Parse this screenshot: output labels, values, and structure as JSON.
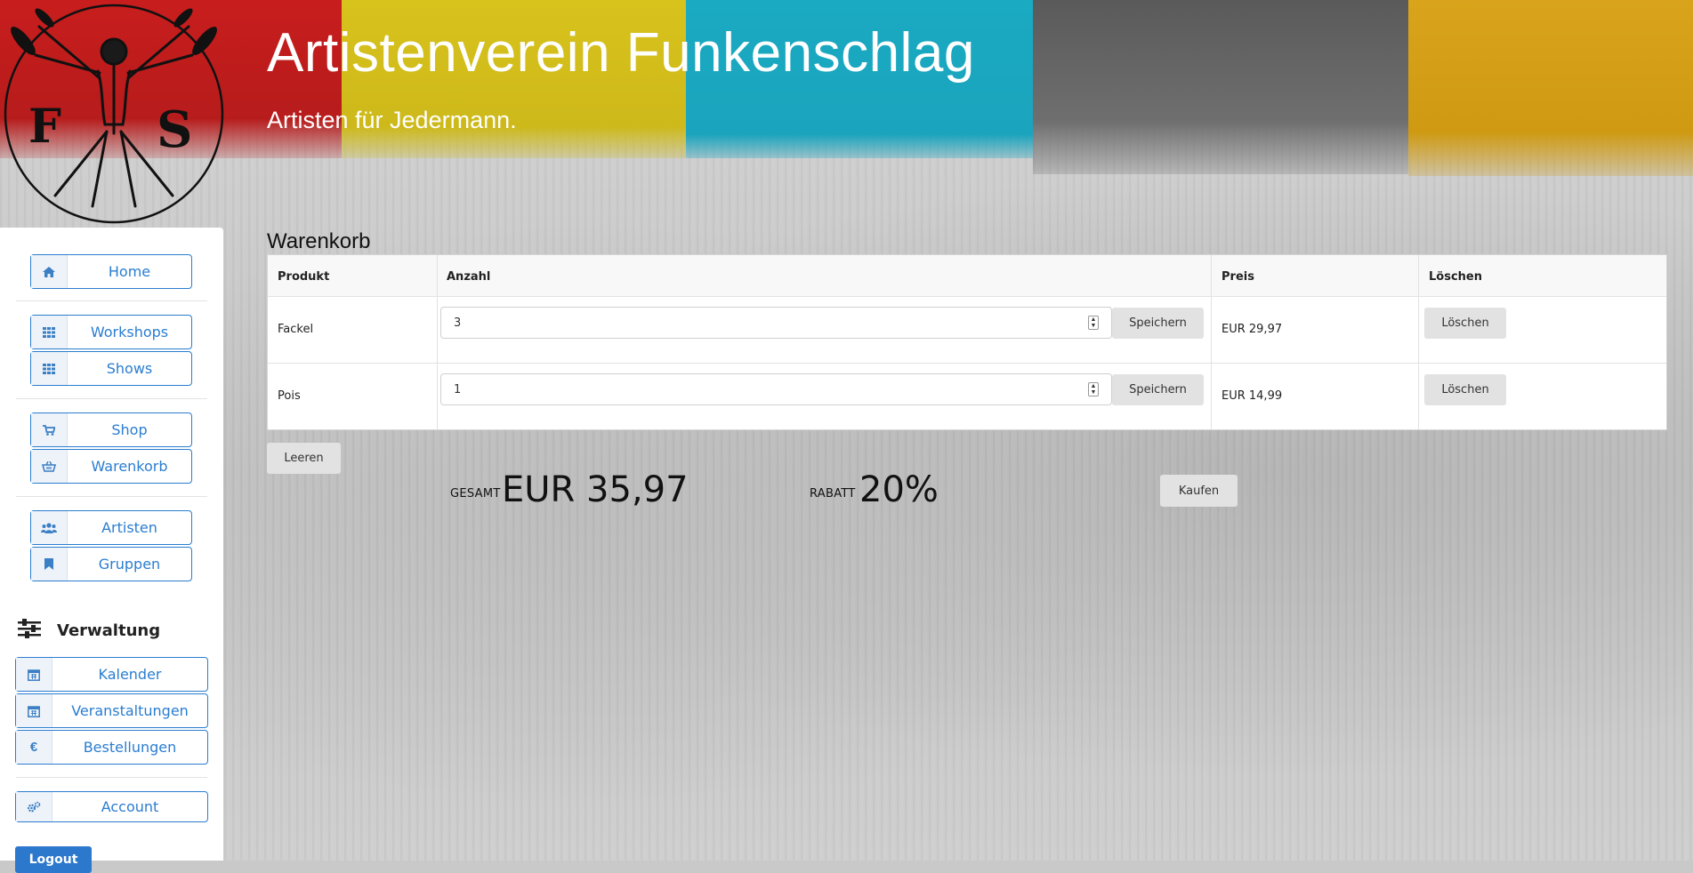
{
  "header": {
    "title": "Artistenverein Funkenschlag",
    "subtitle": "Artisten für Jedermann.",
    "logo_letters": [
      "F",
      "S"
    ]
  },
  "colors": {
    "accent": "#2a7dd0",
    "band_red": "#c81d1d",
    "band_yellow": "#d8c21c",
    "band_cyan": "#1aaac2",
    "band_gray": "#5a5a5a",
    "band_orange": "#d9a41b"
  },
  "sidebar": {
    "items": [
      {
        "label": "Home",
        "icon": "home-icon"
      },
      {
        "label": "Workshops",
        "icon": "grid-icon"
      },
      {
        "label": "Shows",
        "icon": "grid-icon"
      },
      {
        "label": "Shop",
        "icon": "cart-icon"
      },
      {
        "label": "Warenkorb",
        "icon": "basket-icon"
      },
      {
        "label": "Artisten",
        "icon": "users-icon"
      },
      {
        "label": "Gruppen",
        "icon": "bookmark-icon"
      }
    ],
    "admin_section": {
      "label": "Verwaltung",
      "icon": "sliders-icon",
      "items": [
        {
          "label": "Kalender",
          "icon": "calendar-icon"
        },
        {
          "label": "Veranstaltungen",
          "icon": "calendar-icon"
        },
        {
          "label": "Bestellungen",
          "icon": "euro-icon"
        }
      ]
    },
    "account": {
      "label": "Account",
      "icon": "gears-icon"
    },
    "logout": {
      "label": "Logout"
    }
  },
  "cart": {
    "title": "Warenkorb",
    "columns": [
      "Produkt",
      "Anzahl",
      "Preis",
      "Löschen"
    ],
    "rows": [
      {
        "product": "Fackel",
        "quantity": "3",
        "save_label": "Speichern",
        "price": "EUR 29,97",
        "delete_label": "Löschen"
      },
      {
        "product": "Pois",
        "quantity": "1",
        "save_label": "Speichern",
        "price": "EUR 14,99",
        "delete_label": "Löschen"
      }
    ],
    "clear_label": "Leeren",
    "total_label": "GESAMT",
    "total_value": "EUR 35,97",
    "discount_label": "RABATT",
    "discount_value": "20%",
    "buy_label": "Kaufen"
  }
}
